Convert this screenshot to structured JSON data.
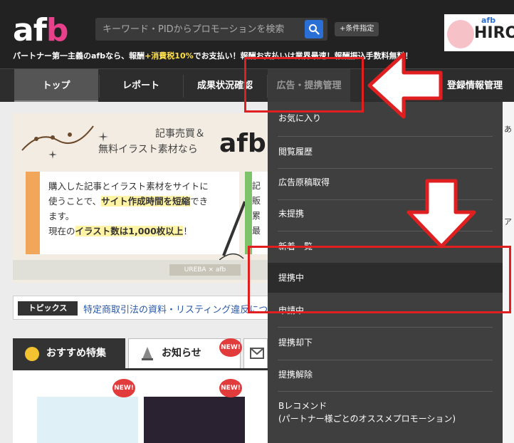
{
  "header": {
    "logo_prefix": "af",
    "logo_accent": "b",
    "search_placeholder": "キーワード・PIDからプロモーションを検索",
    "condition_button": "+条件指定",
    "tagline_a": "パートナー第一主義のafbなら、報酬",
    "tagline_b": "+消費税10%",
    "tagline_c": "でお支払い！報酬お支払いは業界最速！報酬振込手数料無料！",
    "banner_small": "afb",
    "banner_big": "HIRO"
  },
  "nav": {
    "items": [
      "トップ",
      "レポート",
      "成果状況確認",
      "広告・提携管理",
      "登録情報管理"
    ]
  },
  "ad_banner": {
    "head1": "記事売買＆",
    "head2": "無料イラスト素材なら",
    "brand": "afb",
    "line1": "購入した記事とイラスト素材をサイトに",
    "line2a": "使うことで、",
    "line2b": "サイト作成時間を短縮",
    "line2c": "でき",
    "line3": "ます。",
    "line4a": "現在の",
    "line4b": "イラスト数は1,000枚以上",
    "line4c": "！",
    "card2_lines": [
      "記",
      "販",
      "累",
      "最"
    ],
    "strip_label": "UREBA × afb"
  },
  "topics": {
    "label": "トピックス",
    "text": "特定商取引法の資料・リスティング違反について"
  },
  "tabs": {
    "featured": "おすすめ特集",
    "news": "お知らせ",
    "new_badge": "NEW!"
  },
  "dropdown": {
    "items": [
      "お気に入り",
      "閲覧履歴",
      "広告原稿取得",
      "未提携",
      "新着一覧",
      "提携中",
      "申請中",
      "提携却下",
      "提携解除",
      "Bレコメンド",
      "(パートナー様ごとのオススメプロモーション)"
    ]
  },
  "colors": {
    "header_bg": "#222222",
    "nav_bg": "#2d2d2d",
    "dropdown_bg": "#3f3f3f",
    "annotation_red": "#e02020",
    "accent_pink": "#e8408a"
  }
}
